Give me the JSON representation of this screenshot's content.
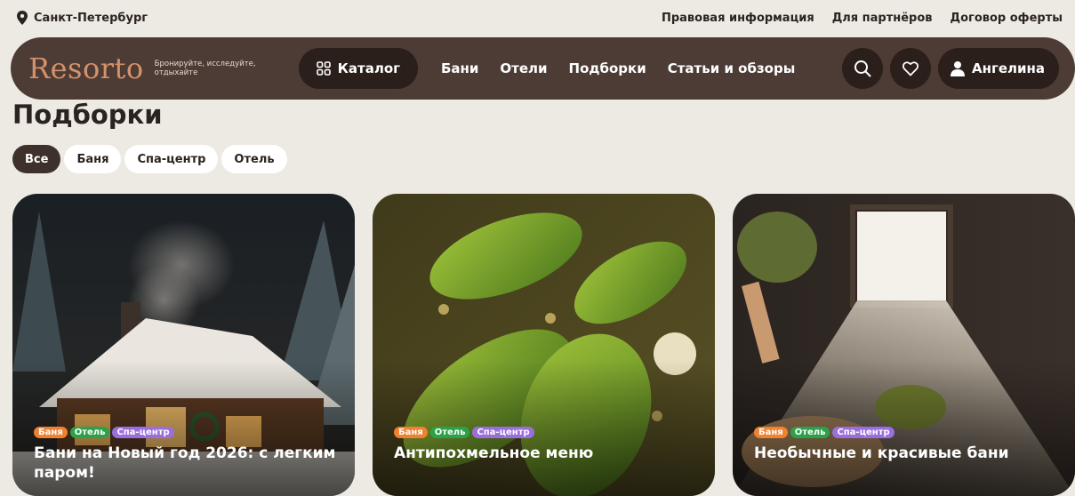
{
  "topbar": {
    "city": "Санкт-Петербург",
    "links": [
      "Правовая информация",
      "Для партнёров",
      "Договор оферты"
    ]
  },
  "header": {
    "logo": "Resorto",
    "tagline": "Бронируйте, исследуйте, отдыхайте",
    "catalog_label": "Каталог",
    "nav": [
      "Бани",
      "Отели",
      "Подборки",
      "Статьи и обзоры"
    ],
    "user_name": "Ангелина",
    "icons": [
      "search-icon",
      "heart-icon",
      "user-icon"
    ]
  },
  "page": {
    "title": "Подборки",
    "filters": [
      {
        "label": "Все",
        "active": true
      },
      {
        "label": "Баня",
        "active": false
      },
      {
        "label": "Спа-центр",
        "active": false
      },
      {
        "label": "Отель",
        "active": false
      }
    ]
  },
  "cards": [
    {
      "tags": [
        "Баня",
        "Отель",
        "Спа-центр"
      ],
      "title": "Бани на Новый год 2026: с легким паром!"
    },
    {
      "tags": [
        "Баня",
        "Отель",
        "Спа-центр"
      ],
      "title": "Антипохмельное меню"
    },
    {
      "tags": [
        "Баня",
        "Отель",
        "Спа-центр"
      ],
      "title": "Необычные и красивые бани"
    }
  ],
  "colors": {
    "background": "#edeae3",
    "header": "#4d3c35",
    "button_dark": "#2a1f1b",
    "logo": "#d4926a",
    "tag_orange": "#f0812f",
    "tag_green": "#2ba24a",
    "tag_purple": "#9b6ee0"
  }
}
